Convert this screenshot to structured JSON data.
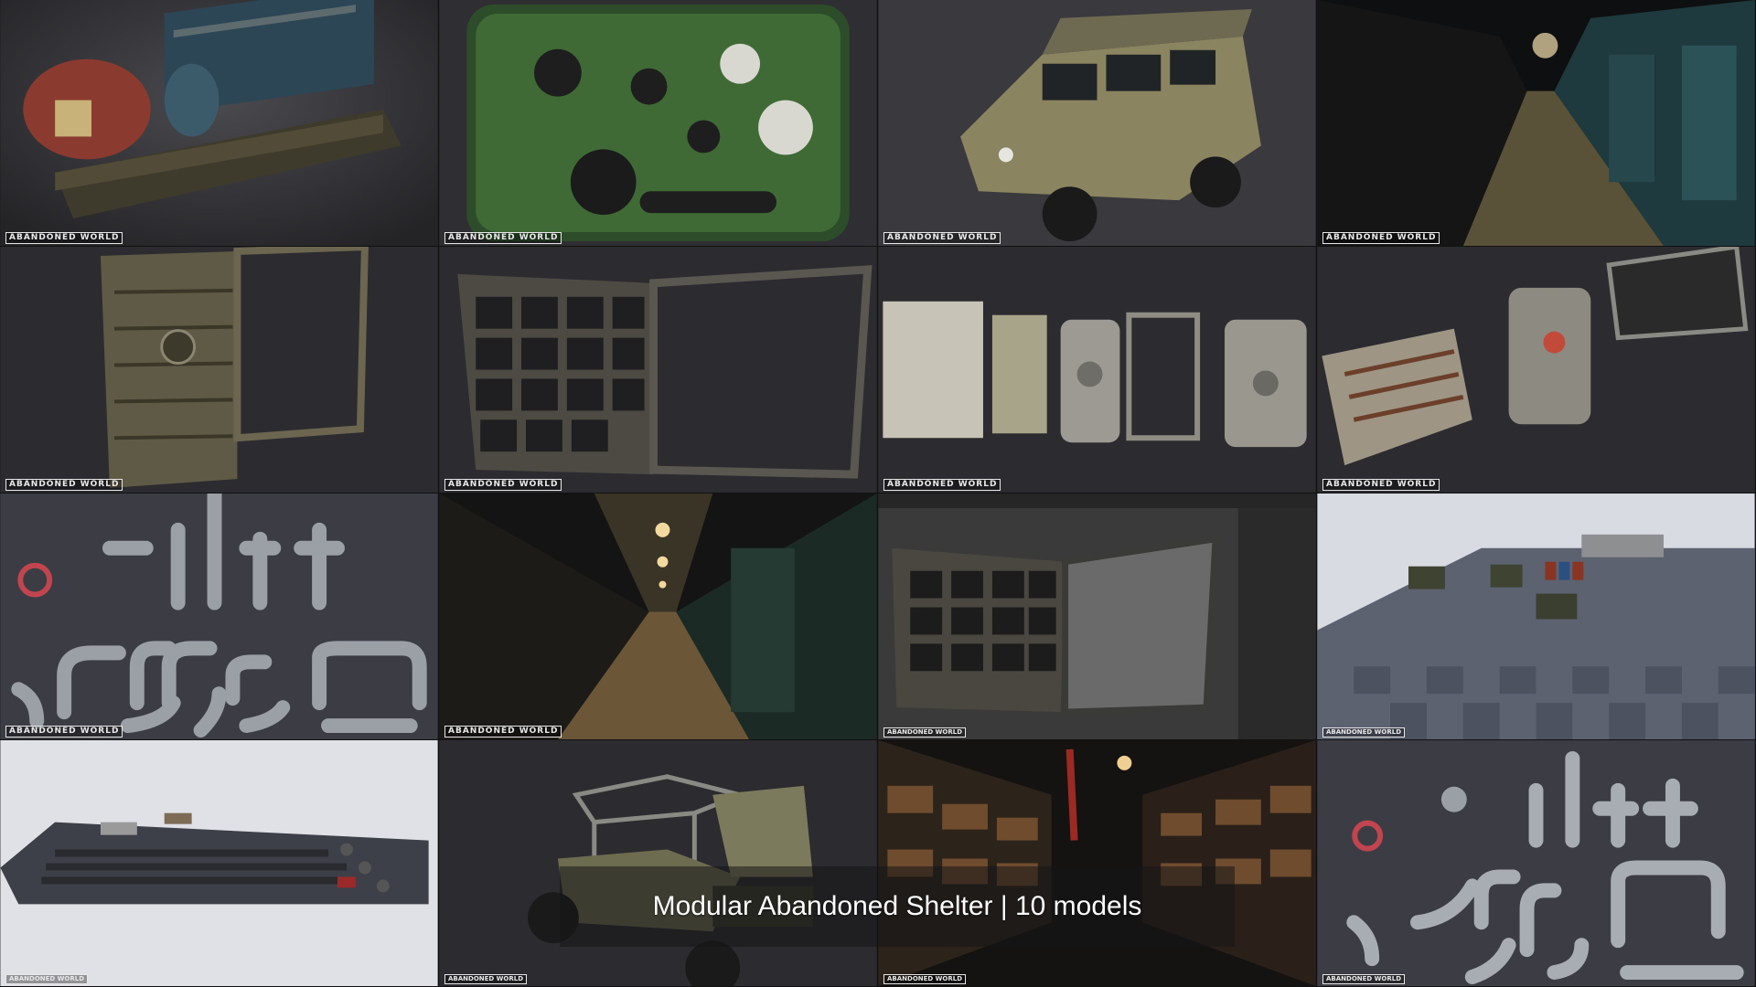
{
  "caption": "Modular Abandoned Shelter | 10 models",
  "watermark_full": "ABANDONED WORLD",
  "watermark_partial": "ABANDONED WORLD",
  "colors": {
    "background": "#1d1d20",
    "caption_text": "#ffffff",
    "pipe_metal": "#9aa0a6",
    "valve_red": "#c0454f",
    "camo_green": "#3f6a35",
    "vehicle_olive": "#8a8460"
  },
  "tiles": [
    {
      "subject": "diesel generator"
    },
    {
      "subject": "radio control panel"
    },
    {
      "subject": "off-road vehicle"
    },
    {
      "subject": "shelter corridor"
    },
    {
      "subject": "blast door"
    },
    {
      "subject": "grated wall panel with open frame"
    },
    {
      "subject": "door set"
    },
    {
      "subject": "vents and hatch doors"
    },
    {
      "subject": "pipe kit with valves"
    },
    {
      "subject": "lit corridor interior"
    },
    {
      "subject": "door frame in 3D editor"
    },
    {
      "subject": "asset overview on checker floor"
    },
    {
      "subject": "full asset layout"
    },
    {
      "subject": "vehicle frame with open hood"
    },
    {
      "subject": "storage room with shelves"
    },
    {
      "subject": "pipe kit with valves"
    }
  ]
}
